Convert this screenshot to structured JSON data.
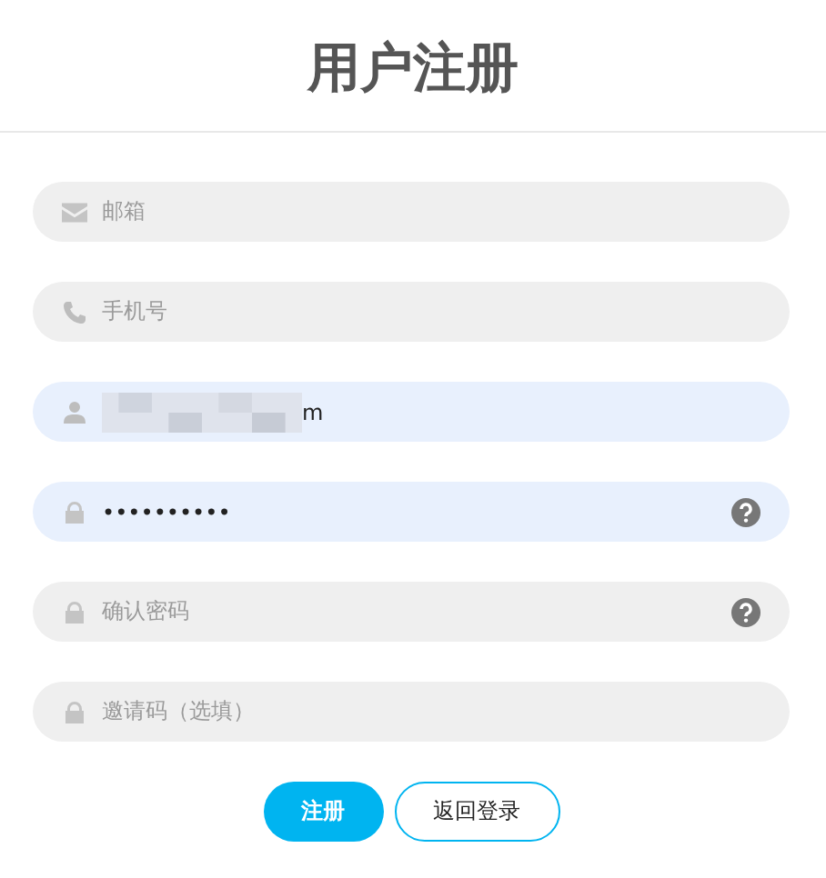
{
  "title": "用户注册",
  "fields": [
    {
      "kind": "mail",
      "placeholder": "邮箱",
      "autofilled": false,
      "help": false
    },
    {
      "kind": "phone",
      "placeholder": "手机号",
      "autofilled": false,
      "help": false
    },
    {
      "kind": "user",
      "value": "m",
      "redacted": true,
      "autofilled": true,
      "help": false
    },
    {
      "kind": "lock",
      "value": "••••••••••",
      "autofilled": true,
      "help": true
    },
    {
      "kind": "lock",
      "placeholder": "确认密码",
      "autofilled": false,
      "help": true
    },
    {
      "kind": "lock",
      "placeholder": "邀请码（选填）",
      "autofilled": false,
      "help": false
    }
  ],
  "buttons": [
    {
      "label": "注册",
      "kind": "primary"
    },
    {
      "label": "返回登录",
      "kind": "outline"
    }
  ]
}
